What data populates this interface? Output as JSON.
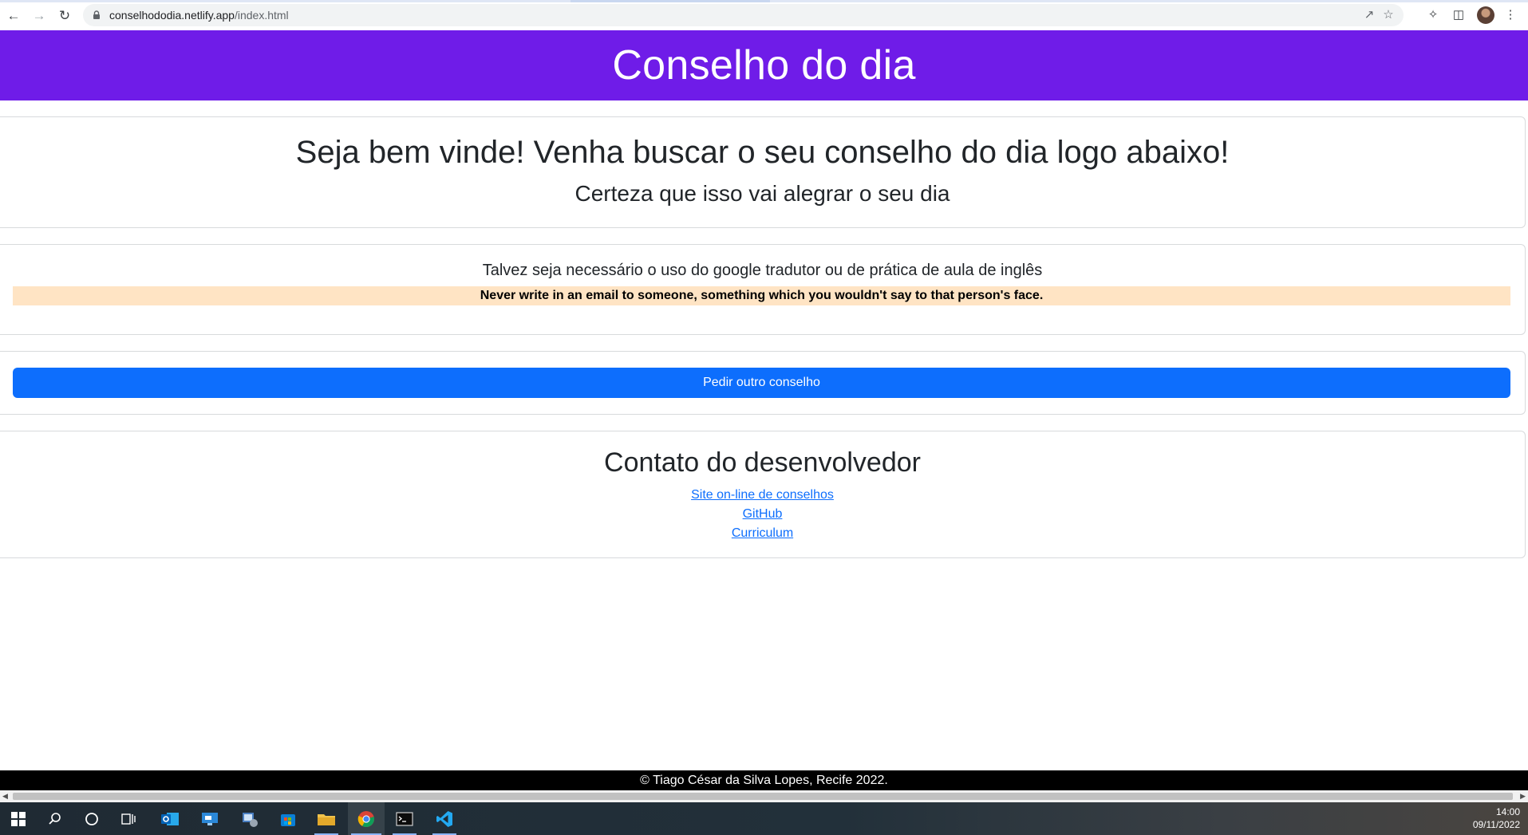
{
  "browser": {
    "url_host": "conselhododia.netlify.app",
    "url_path": "/index.html"
  },
  "header": {
    "title": "Conselho do dia"
  },
  "welcome": {
    "title": "Seja bem vinde! Venha buscar o seu conselho do dia logo abaixo!",
    "subtitle": "Certeza que isso vai alegrar o seu dia"
  },
  "advice": {
    "note": "Talvez seja necessário o uso do google tradutor ou de prática de aula de inglês",
    "text": "Never write in an email to someone, something which you wouldn't say to that person's face."
  },
  "action": {
    "button_label": "Pedir outro conselho"
  },
  "contact": {
    "title": "Contato do desenvolvedor",
    "links": [
      "Site on-line de conselhos",
      "GitHub",
      "Curriculum"
    ]
  },
  "footer": {
    "text": "© Tiago César da Silva Lopes, Recife 2022."
  },
  "taskbar": {
    "time": "14:00",
    "date": "09/11/2022",
    "icons": [
      "windows-start-icon",
      "search-icon",
      "cortana-icon",
      "task-view-icon",
      "outlook-icon",
      "remote-desktop-icon",
      "network-tool-icon",
      "store-icon",
      "file-explorer-icon",
      "chrome-icon",
      "terminal-icon",
      "vscode-icon"
    ]
  },
  "colors": {
    "header_bg": "#6f1ce8",
    "button_bg": "#0d6efd",
    "advice_bg": "#ffe4c4",
    "link": "#0d6efd"
  }
}
